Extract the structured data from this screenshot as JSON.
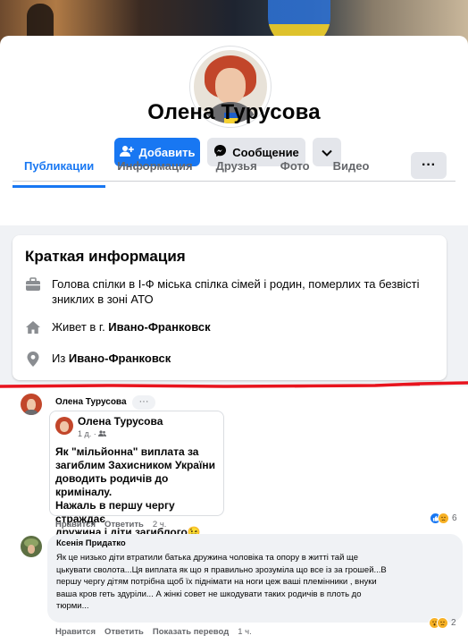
{
  "profile": {
    "name": "Олена Турусова",
    "add_friend_label": "Добавить",
    "message_label": "Сообщение",
    "tabs": [
      {
        "label": "Публикации",
        "active": true
      },
      {
        "label": "Информация",
        "active": false
      },
      {
        "label": "Друзья",
        "active": false
      },
      {
        "label": "Фото",
        "active": false
      },
      {
        "label": "Видео",
        "active": false
      }
    ],
    "tab_more_label": "···"
  },
  "intro": {
    "title": "Краткая информация",
    "work_line1": "Голова спілки в І-Ф міська спілка сімей і родин, померлих та безвісті",
    "work_line2": "зниклих в зоні АТО",
    "lives_prefix": "Живет в г. ",
    "lives_city": "Ивано-Франковск",
    "from_prefix": "Из ",
    "from_city": "Ивано-Франковск"
  },
  "comment1": {
    "author": "Олена Турусова",
    "dots": "···",
    "shared_post": {
      "author": "Олена Турусова",
      "meta": "1 д. · ",
      "text_lines": [
        "Як \"мільйонна\" виплата за",
        "загиблим Захисником України",
        "доводить родичів до криміналу.",
        "Нажаль в першу чергу страждає",
        "дружина і діти загиблого😉"
      ]
    },
    "like_label": "Нравится",
    "reply_label": "Ответить",
    "time": "2 ч.",
    "reaction_count": "6"
  },
  "comment2": {
    "author": "Ксенія Придатко",
    "text_lines": [
      "Як це низько діти втратили батька дружина чоловіка та опору в житті тай ще",
      "цькувати сволота...Ця виплата як що я правильно зрозуміла що все із за грошей...В",
      "першу чергу дітям потрібна щоб їх піднімати на ноги цеж ваші племінники , внуки",
      "ваша кров геть здуріли... А жінкі совет не шкодувати таких родичів в плоть до",
      "тюрми..."
    ],
    "like_label": "Нравится",
    "reply_label": "Ответить",
    "translate_label": "Показать перевод",
    "time": "1 ч.",
    "reaction_count": "2"
  },
  "colors": {
    "accent": "#1877f2",
    "red_divider": "#e8141e",
    "secondary_button": "#e4e6eb",
    "muted_text": "#65676b"
  }
}
